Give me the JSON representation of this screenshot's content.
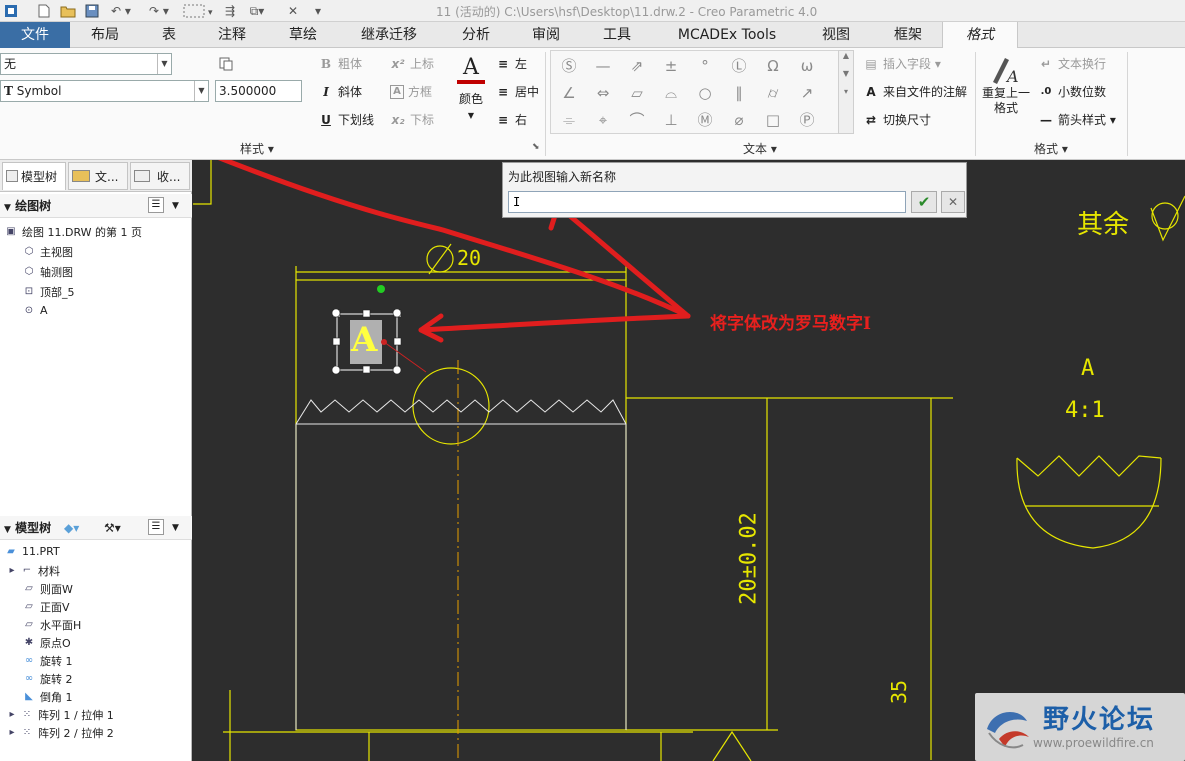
{
  "window": {
    "title": "11 (活动的) C:\\Users\\hsf\\Desktop\\11.drw.2 - Creo Parametric 4.0"
  },
  "tabs": [
    {
      "label": "文件"
    },
    {
      "label": "布局"
    },
    {
      "label": "表"
    },
    {
      "label": "注释"
    },
    {
      "label": "草绘"
    },
    {
      "label": "继承迁移"
    },
    {
      "label": "分析"
    },
    {
      "label": "审阅"
    },
    {
      "label": "工具"
    },
    {
      "label": "MCADEx Tools"
    },
    {
      "label": "视图"
    },
    {
      "label": "框架"
    },
    {
      "label": "格式"
    }
  ],
  "ribbon": {
    "style_combo": "无",
    "font_combo": "Symbol",
    "font_prefix": "T",
    "height_value": "3.500000",
    "bold": "粗体",
    "italic": "斜体",
    "underline": "下划线",
    "superscript": "上标",
    "box": "方框",
    "subscript": "下标",
    "color": "颜色",
    "align_left": "左",
    "align_center": "居中",
    "align_right": "右",
    "style_group_label": "样式",
    "text_group_label": "文本",
    "insert_field": "插入字段",
    "from_file_annotation": "来自文件的注解",
    "toggle_dimension": "切换尺寸",
    "repeat_last_format": "重复上一格式",
    "text_wrap": "文本换行",
    "decimal_places": "小数位数",
    "arrow_style": "箭头样式",
    "format_group_label": "格式"
  },
  "left_panel": {
    "tabs": [
      {
        "label": "模型树"
      },
      {
        "label": "文..."
      },
      {
        "label": "收..."
      }
    ],
    "drawing_tree_title": "绘图树",
    "drawing_tree": [
      {
        "label": "绘图 11.DRW 的第 1 页"
      },
      {
        "label": "主视图"
      },
      {
        "label": "轴测图"
      },
      {
        "label": "顶部_5"
      },
      {
        "label": "A"
      }
    ],
    "model_tree_title": "模型树",
    "model_tree": [
      {
        "label": "11.PRT"
      },
      {
        "label": "材料"
      },
      {
        "label": "则面W"
      },
      {
        "label": "正面V"
      },
      {
        "label": "水平面H"
      },
      {
        "label": "原点O"
      },
      {
        "label": "旋转 1"
      },
      {
        "label": "旋转 2"
      },
      {
        "label": "倒角 1"
      },
      {
        "label": "阵列 1 / 拉伸 1"
      },
      {
        "label": "阵列 2 / 拉伸 2"
      }
    ]
  },
  "popup": {
    "title": "为此视图输入新名称",
    "value": "I"
  },
  "drawing": {
    "diameter": "20",
    "note_letter": "A",
    "roughness": "其余",
    "detail_label": "A",
    "detail_scale": "4:1",
    "vertical_dim": "20±0.02",
    "dim_35": "35"
  },
  "annotation": "将字体改为罗马数字I",
  "watermark": {
    "title": "野火论坛",
    "url": "www.proewildfire.cn"
  }
}
